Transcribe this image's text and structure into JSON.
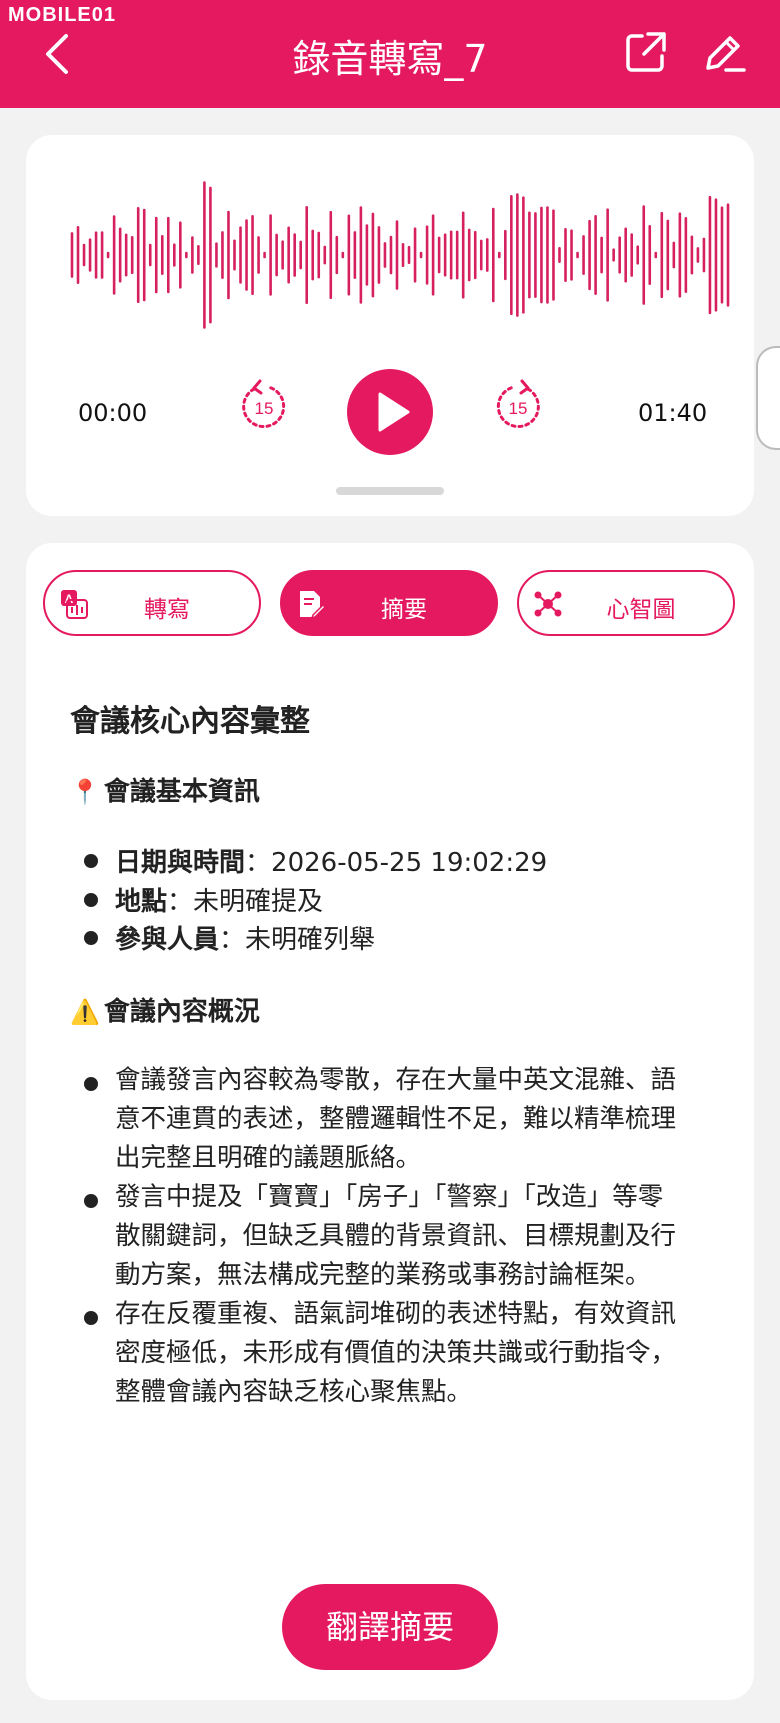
{
  "watermark": "MOBILE01",
  "header": {
    "title": "錄音轉寫_7"
  },
  "player": {
    "current_time": "00:00",
    "total_time": "01:40",
    "skip_back_seconds": "15",
    "skip_forward_seconds": "15",
    "progress": 0
  },
  "tabs": [
    {
      "label": "轉寫",
      "icon": "transcribe-icon",
      "active": false
    },
    {
      "label": "摘要",
      "icon": "summary-icon",
      "active": true
    },
    {
      "label": "心智圖",
      "icon": "mindmap-icon",
      "active": false
    }
  ],
  "summary": {
    "title": "會議核心內容彙整",
    "basic_info": {
      "heading_icon": "📍",
      "heading": "會議基本資訊",
      "items": [
        {
          "key": "日期與時間",
          "sep": "：",
          "value": "2026-05-25 19:02:29"
        },
        {
          "key": "地點",
          "sep": "：",
          "value": "未明確提及"
        },
        {
          "key": "參與人員",
          "sep": "：",
          "value": "未明確列舉"
        }
      ]
    },
    "overview": {
      "heading_icon": "⚠️",
      "heading": "會議內容概況",
      "items": [
        {
          "lines": [
            "會議發言內容較為零散，存在大量中英文混雜、語",
            "意不連貫的表述，整體邏輯性不足，難以精準梳理",
            "出完整且明確的議題脈絡。"
          ]
        },
        {
          "lines": [
            "發言中提及「寶寶」「房子」「警察」「改造」等零",
            "散關鍵詞，但缺乏具體的背景資訊、目標規劃及行",
            "動方案，無法構成完整的業務或事務討論框架。"
          ]
        },
        {
          "lines": [
            "存在反覆重複、語氣詞堆砌的表述特點，有效資訊",
            "密度極低，未形成有價值的決策共識或行動指令，",
            "整體會議內容缺乏核心聚焦點。"
          ]
        }
      ]
    }
  },
  "translate_button": "翻譯摘要",
  "colors": {
    "accent": "#e5195f",
    "background": "#f2f2f2",
    "card": "#ffffff"
  }
}
